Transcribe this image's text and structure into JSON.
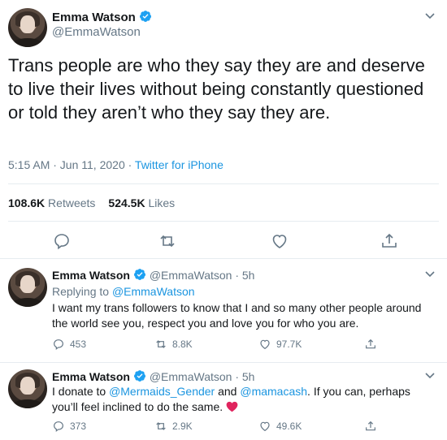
{
  "main": {
    "name": "Emma Watson",
    "handle": "@EmmaWatson",
    "text": "Trans people are who they say they are and deserve to live their lives without being constantly questioned or told they aren’t who they say they are.",
    "time": "5:15 AM · Jun 11, 2020 · ",
    "source": "Twitter for iPhone",
    "retweets_count": "108.6K",
    "retweets_label": " Retweets",
    "likes_count": "524.5K",
    "likes_label": " Likes"
  },
  "replies": [
    {
      "name": "Emma Watson",
      "handle_time": " @EmmaWatson · 5h",
      "replying_prefix": "Replying to ",
      "replying_to": "@EmmaWatson",
      "text": "I want my trans followers to know that I and so many other people around the world see you, respect you and love you for who you are.",
      "reply_count": "453",
      "retweet_count": "8.8K",
      "like_count": "97.7K"
    },
    {
      "name": "Emma Watson",
      "handle_time": " @EmmaWatson · 5h",
      "text_a": "I donate to ",
      "mention_a": "@Mermaids_Gender",
      "text_b": " and ",
      "mention_b": "@mamacash",
      "text_c": ". If you can, perhaps you’ll feel inclined to do the same.",
      "reply_count": "373",
      "retweet_count": "2.9K",
      "like_count": "49.6K"
    }
  ],
  "colors": {
    "accent": "#1b95e0",
    "muted": "#657786",
    "heart": "#e0245e"
  },
  "icons": [
    "verified-badge-icon",
    "chevron-down-icon",
    "reply-icon",
    "retweet-icon",
    "like-icon",
    "share-icon",
    "red-heart-emoji"
  ]
}
